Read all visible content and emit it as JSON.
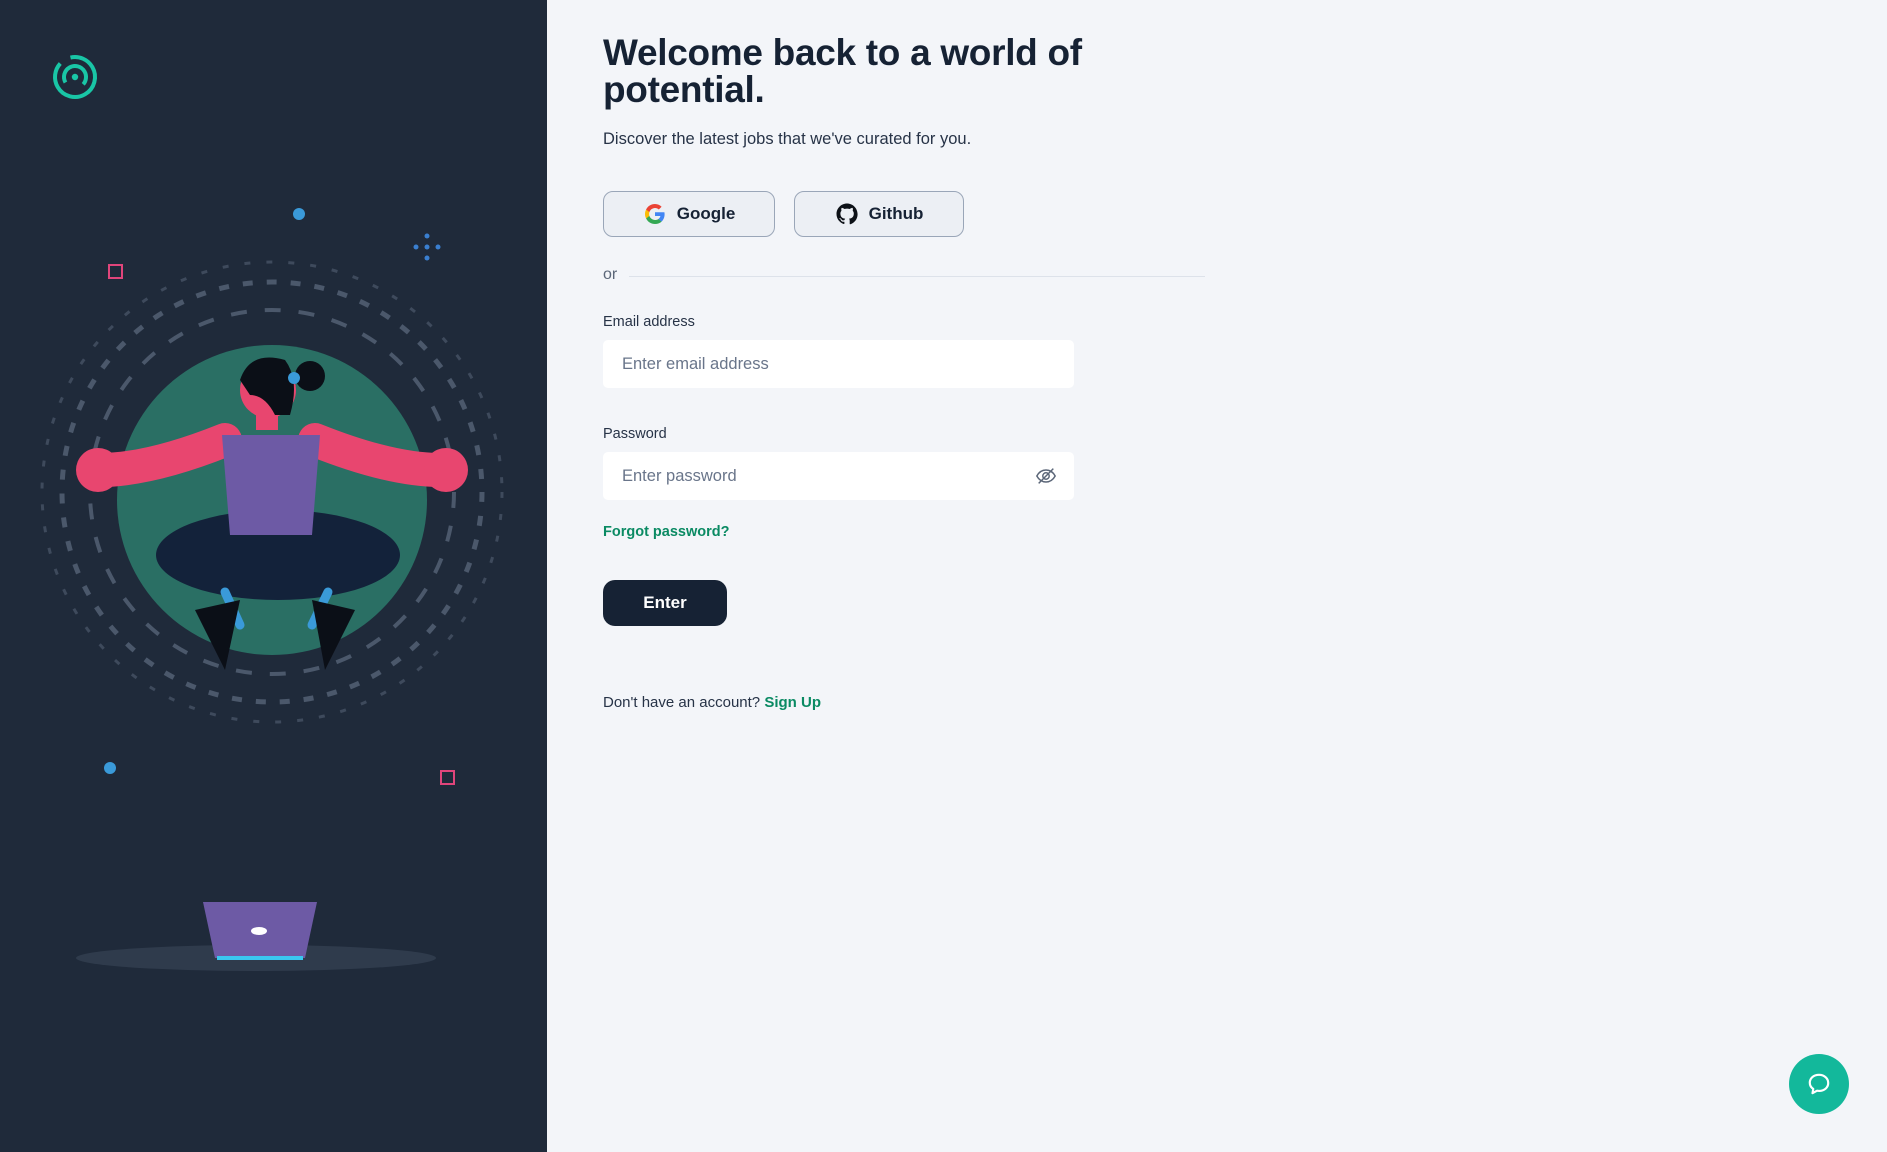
{
  "header": {
    "title": "Welcome back to a world of potential.",
    "subtitle": "Discover the latest jobs that we've curated for you."
  },
  "oauth": {
    "google_label": "Google",
    "github_label": "Github"
  },
  "divider": {
    "or_label": "or"
  },
  "form": {
    "email_label": "Email address",
    "email_placeholder": "Enter email address",
    "password_label": "Password",
    "password_placeholder": "Enter password",
    "forgot_label": "Forgot password?",
    "submit_label": "Enter"
  },
  "signup": {
    "prompt": "Don't have an account?",
    "link_label": "Sign Up"
  },
  "icons": {
    "logo": "brand-logo-icon",
    "google": "google-icon",
    "github": "github-icon",
    "password_toggle": "eye-off-icon",
    "chat": "chat-bubble-icon"
  },
  "colors": {
    "left_panel_bg": "#1f2a3a",
    "page_bg": "#f3f5f9",
    "accent_green": "#0a8a63",
    "chat_button": "#13b89b",
    "primary_button": "#162234"
  }
}
